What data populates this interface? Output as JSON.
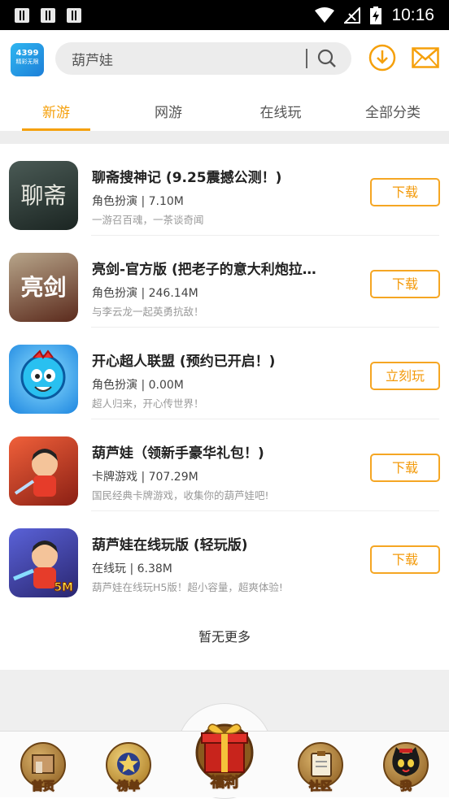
{
  "statusbar": {
    "time": "10:16"
  },
  "header": {
    "logo_text": "4399",
    "logo_sub": "精彩无限",
    "search_value": "葫芦娃"
  },
  "tabs": [
    {
      "label": "新游",
      "active": true
    },
    {
      "label": "网游",
      "active": false
    },
    {
      "label": "在线玩",
      "active": false
    },
    {
      "label": "全部分类",
      "active": false
    }
  ],
  "games": [
    {
      "title": "聊斋搜神记 (9.25震撼公测！)",
      "meta": "角色扮演 | 7.10M",
      "desc": "一游召百魂，一茶谈奇闻",
      "button": "下载",
      "icon": "liaozhai-icon",
      "icon_text": "聊斋",
      "color": "#2a3a35"
    },
    {
      "title": "亮剑-官方版 (把老子的意大利炮拉…",
      "meta": "角色扮演 | 246.14M",
      "desc": "与李云龙一起英勇抗敌！",
      "button": "下载",
      "icon": "liangjian-icon",
      "icon_text": "亮剑",
      "color": "#6b2a1e"
    },
    {
      "title": "开心超人联盟 (预约已开启！)",
      "meta": "角色扮演 | 0.00M",
      "desc": "超人归来，开心传世界！",
      "button": "立刻玩",
      "icon": "kaixin-icon",
      "icon_text": "",
      "color": "#1f8ee8"
    },
    {
      "title": "葫芦娃（领新手豪华礼包！)",
      "meta": "卡牌游戏 | 707.29M",
      "desc": "国民经典卡牌游戏，收集你的葫芦娃吧!",
      "button": "下载",
      "icon": "huluwa-icon",
      "icon_text": "",
      "color": "#d6402a"
    },
    {
      "title": "葫芦娃在线玩版 (轻玩版)",
      "meta": "在线玩 | 6.38M",
      "desc": "葫芦娃在线玩H5版！超小容量，超爽体验!",
      "button": "下载",
      "icon": "huluwa-h5-icon",
      "icon_text": "5M",
      "color": "#3b3fa8"
    }
  ],
  "list_end": "暂无更多",
  "bottom_nav": [
    {
      "label": "首页",
      "icon": "home-shop-icon"
    },
    {
      "label": "榜单",
      "icon": "star-badge-icon"
    },
    {
      "label": "福利",
      "icon": "gift-box-icon"
    },
    {
      "label": "社区",
      "icon": "clipboard-icon"
    },
    {
      "label": "我",
      "icon": "cat-avatar-icon"
    }
  ]
}
